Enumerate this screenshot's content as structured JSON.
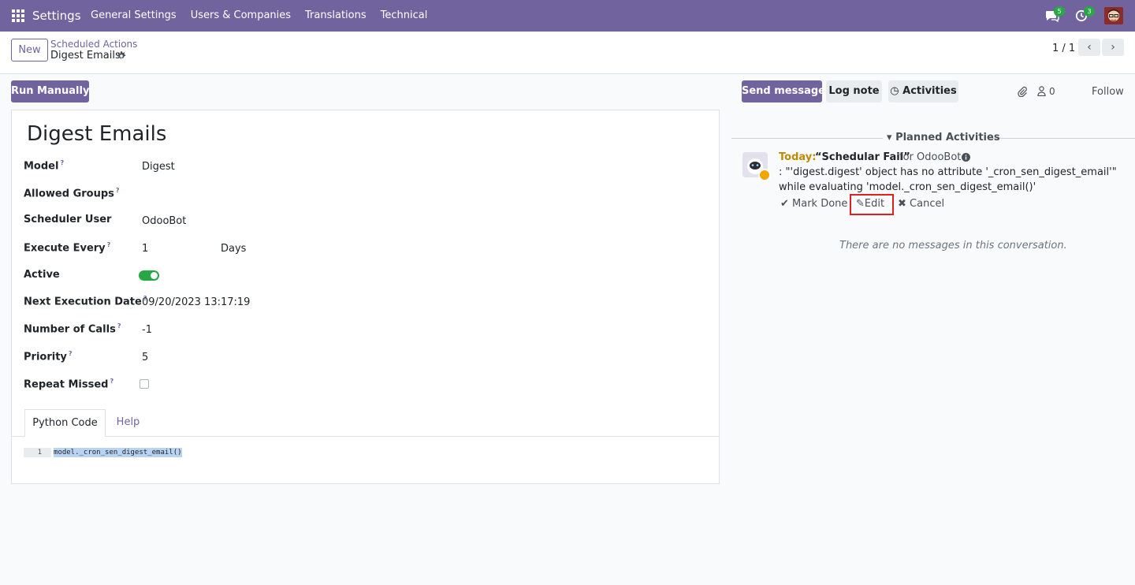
{
  "navbar": {
    "brand": "Settings",
    "menu": [
      "General Settings",
      "Users & Companies",
      "Translations",
      "Technical"
    ],
    "messages_badge": "5",
    "activities_badge": "3"
  },
  "control_panel": {
    "new_label": "New",
    "breadcrumb_parent": "Scheduled Actions",
    "breadcrumb_current": "Digest Emails",
    "pager": "1 / 1"
  },
  "form": {
    "run_label": "Run Manually",
    "title": "Digest Emails",
    "help_mark": "?",
    "fields": {
      "model_label": "Model",
      "model_value": "Digest",
      "groups_label": "Allowed Groups",
      "user_label": "Scheduler User",
      "user_value": "OdooBot",
      "every_label": "Execute Every",
      "every_value": "1",
      "every_unit": "Days",
      "active_label": "Active",
      "active_value": true,
      "next_label": "Next Execution Date",
      "next_value": "09/20/2023 13:17:19",
      "calls_label": "Number of Calls",
      "calls_value": "-1",
      "priority_label": "Priority",
      "priority_value": "5",
      "repeat_label": "Repeat Missed",
      "repeat_value": false
    },
    "tabs": [
      "Python Code",
      "Help"
    ],
    "code_line_no": "1",
    "code": "model._cron_sen_digest_email()"
  },
  "chatter": {
    "send_label": "Send message",
    "log_label": "Log note",
    "activities_label": "Activities",
    "follower_count": "0",
    "follow_label": "Follow",
    "planned_heading": "Planned Activities",
    "activity": {
      "date": "Today:",
      "summary": "“Schedular Fail”",
      "for": "for OdooBot",
      "note": ": \"'digest.digest' object has no attribute '_cron_sen_digest_email'\" while evaluating 'model._cron_sen_digest_email()'",
      "mark_done": "Mark Done",
      "edit": "Edit",
      "cancel": "Cancel"
    },
    "empty_message": "There are no messages in this conversation."
  },
  "colors": {
    "brand": "#71639e",
    "toggle_on": "#28a745",
    "highlight": "#e02020",
    "activity_today": "#bd8b00"
  }
}
